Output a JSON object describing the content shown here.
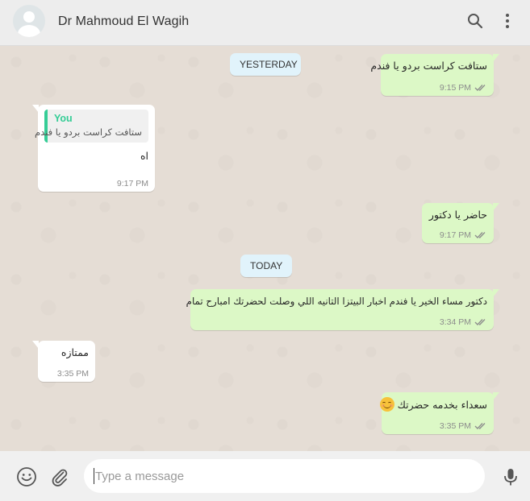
{
  "header": {
    "contact_name": "Dr Mahmoud El Wagih",
    "icons": [
      "avatar",
      "search-icon",
      "menu-icon"
    ]
  },
  "dates": {
    "yesterday": "YESTERDAY",
    "today": "TODAY"
  },
  "messages": [
    {
      "direction": "out",
      "text": "ستافت كراست بردو يا فندم",
      "time": "9:15 PM",
      "status": "read"
    },
    {
      "direction": "in",
      "quote_author": "You",
      "quote_text": "ستافت كراست بردو يا فندم",
      "text": "اه",
      "time": "9:17 PM"
    },
    {
      "direction": "out",
      "text": "حاضر يا دكتور",
      "time": "9:17 PM",
      "status": "read"
    },
    {
      "direction": "out",
      "text": "دكتور مساء الخير يا فندم اخبار البيتزا التانيه اللي وصلت لحضرتك امبارح تمام",
      "time": "3:34 PM",
      "status": "read"
    },
    {
      "direction": "in",
      "text": "ممتازه",
      "time": "3:35 PM"
    },
    {
      "direction": "out",
      "text": "سعداء بخدمه حضرتك",
      "emoji": "smiling-face-icon",
      "time": "3:35 PM",
      "status": "read"
    }
  ],
  "composer": {
    "placeholder": "Type a message",
    "icons": [
      "emoji-icon",
      "attach-icon",
      "mic-icon"
    ]
  },
  "colors": {
    "outgoing_bubble": "#dcf8c6",
    "incoming_bubble": "#ffffff",
    "date_pill": "#e1f3fb",
    "quote_accent": "#35cd96",
    "read_ticks": "#8c8c8c"
  }
}
